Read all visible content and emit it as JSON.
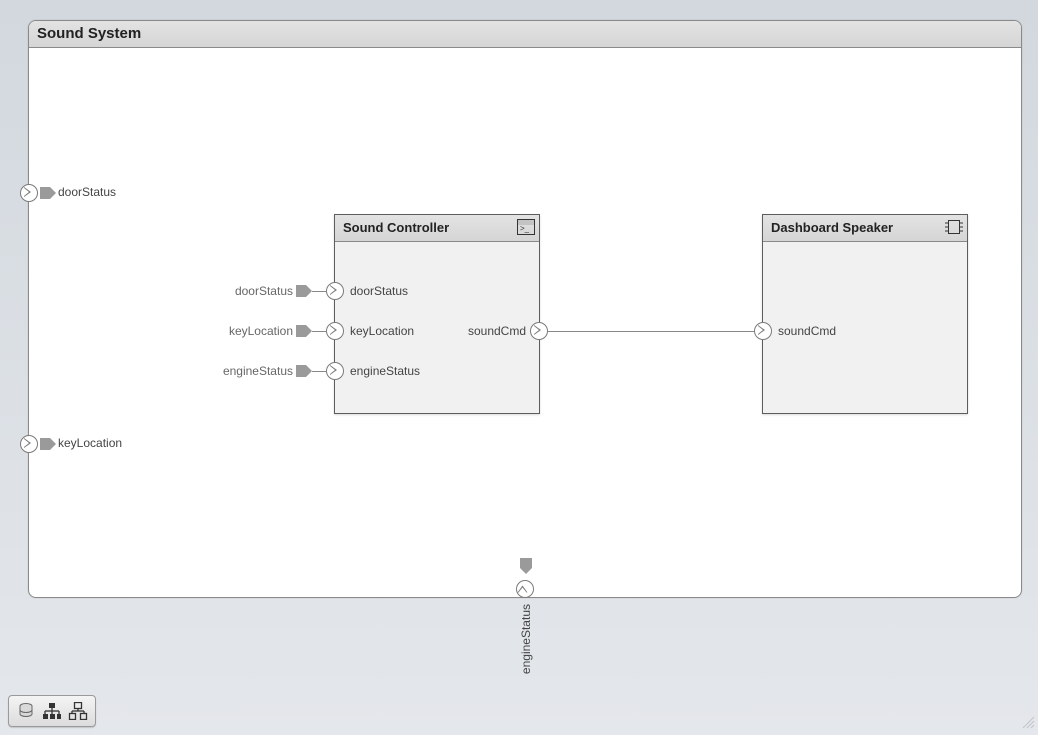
{
  "system": {
    "title": "Sound System",
    "external_ports": {
      "left": [
        {
          "label": "doorStatus"
        },
        {
          "label": "keyLocation"
        }
      ],
      "bottom": [
        {
          "label": "engineStatus"
        }
      ]
    }
  },
  "blocks": {
    "controller": {
      "title": "Sound Controller",
      "inputs": [
        {
          "label": "doorStatus"
        },
        {
          "label": "keyLocation"
        },
        {
          "label": "engineStatus"
        }
      ],
      "outputs": [
        {
          "label": "soundCmd"
        }
      ],
      "input_wire_labels": {
        "0": "doorStatus",
        "1": "keyLocation",
        "2": "engineStatus"
      }
    },
    "speaker": {
      "title": "Dashboard Speaker",
      "inputs": [
        {
          "label": "soundCmd"
        }
      ],
      "outputs": []
    }
  },
  "wires": [
    {
      "from": "controller.out.soundCmd",
      "to": "speaker.in.soundCmd"
    }
  ],
  "toolbar": {
    "buttons": [
      {
        "name": "database-icon"
      },
      {
        "name": "tree-icon"
      },
      {
        "name": "hierarchy-icon"
      }
    ]
  },
  "colors": {
    "border": "#8a8a8a",
    "headerBg": "#dedede",
    "port": "#7a7a7a"
  }
}
